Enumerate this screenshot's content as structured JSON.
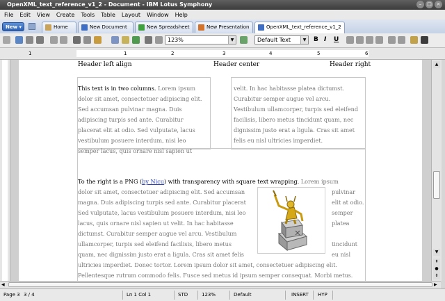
{
  "window": {
    "title": "OpenXML_text_reference_v1_2 - Document - IBM Lotus Symphony"
  },
  "menu": [
    "File",
    "Edit",
    "View",
    "Create",
    "Tools",
    "Table",
    "Layout",
    "Window",
    "Help"
  ],
  "tabs": {
    "new_label": "New",
    "items": [
      {
        "label": "Home"
      },
      {
        "label": "New Document"
      },
      {
        "label": "New Spreadsheet"
      },
      {
        "label": "New Presentation"
      },
      {
        "label": "OpenXML_text_reference_v1_2"
      }
    ]
  },
  "toolbar": {
    "zoom_value": "123%",
    "style_value": "Default Text",
    "bold": "B",
    "italic": "I",
    "underline": "U"
  },
  "ruler": {
    "numbers": [
      "1",
      "1",
      "2",
      "3",
      "4",
      "5",
      "6"
    ]
  },
  "document": {
    "header": {
      "left": "Header left align",
      "center": "Header center",
      "right": "Header right"
    },
    "col1": [
      "dolor sit amet, consectetuer adipiscing elit.",
      "Sed accumsan pulvinar magna. Duis",
      "adipiscing turpis sed ante. Curabitur",
      "placerat elit at odio. Sed vulputate, lacus",
      "vestibulum posuere interdum, nisi leo",
      "semper lacus, quis ornare nisl sapien ut"
    ],
    "col1_first_bold": "This text is in two columns.",
    "col1_first_rest": "  Lorem ipsum",
    "col2": [
      "velit. In hac habitasse platea dictumst.",
      "Curabitur semper augue vel arcu.",
      "Vestibulum ullamcorper, turpis sed eleifend",
      "facilisis, libero metus tincidunt quam, nec",
      "dignissim justo erat a ligula. Cras sit amet",
      "felis eu nisl ultricies imperdiet."
    ],
    "png": {
      "line1_prefix": "To the right is a PNG (",
      "link": "by Nicu",
      "line1_suffix": ") with transparency with square text wrapping.",
      "line1_rest": "Lorem ipsum",
      "left_lines": [
        "dolor sit amet, consectetuer adipiscing elit. Sed accumsan",
        "magna. Duis adipiscing turpis sed ante. Curabitur placerat",
        "Sed vulputate, lacus vestibulum posuere interdum, nisi leo",
        "lacus, quis ornare nisl sapien ut velit. In hac habitasse",
        "dictumst. Curabitur semper augue vel arcu. Vestibulum",
        "ullamcorper, turpis sed eleifend facilisis, libero metus",
        "quam, nec dignissim justo erat a ligula. Cras sit amet felis"
      ],
      "right_lines": [
        "pulvinar",
        "elit at odio.",
        "semper",
        "platea",
        "",
        "tincidunt",
        "eu nisl"
      ],
      "bottom_lines": [
        "ultricies imperdiet. Donec tortor. Lorem ipsum dolor sit amet, consectetuer adipiscing elit.",
        "Pellentesque rutrum commodo felis. Fusce sed metus id ipsum semper consequat. Morbi metus."
      ]
    }
  },
  "status": {
    "page": "Page 3",
    "pages": "3 / 4",
    "position": "Ln 1 Col 1",
    "mode": "STD",
    "zoom": "123%",
    "style": "Default",
    "insert": "INSERT",
    "hyp": "HYP"
  }
}
